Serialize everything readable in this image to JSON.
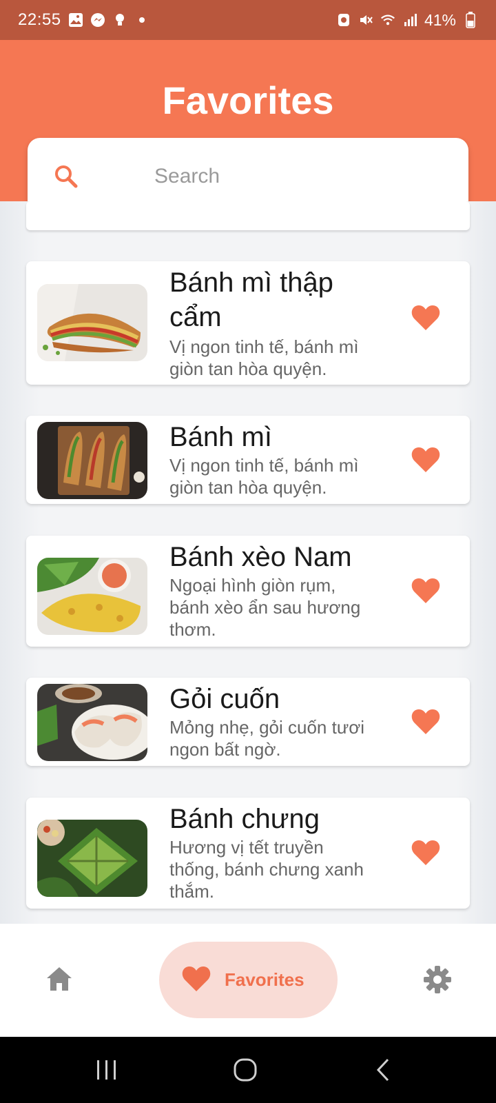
{
  "status_bar": {
    "time": "22:55",
    "battery_percent": "41%",
    "icons_left": [
      "gallery-icon",
      "messenger-icon",
      "bulb-icon",
      "dot-icon"
    ],
    "icons_right": [
      "battery-saver-icon",
      "mute-icon",
      "wifi-icon",
      "signal-icon",
      "battery-icon"
    ]
  },
  "header": {
    "title": "Favorites",
    "background_color": "#f57753"
  },
  "search": {
    "placeholder": "Search",
    "icon": "search-icon"
  },
  "favorites": [
    {
      "title": "Bánh mì thập cẩm",
      "description": "Vị ngon tinh tế, bánh mì giòn tan hòa quyện.",
      "image": "banh-mi-thap-cam-photo",
      "favorited": true
    },
    {
      "title": "Bánh mì",
      "description": "Vị ngon tinh tế, bánh mì giòn tan hòa quyện.",
      "image": "banh-mi-photo",
      "favorited": true
    },
    {
      "title": "Bánh xèo Nam",
      "description": "Ngoại hình giòn rụm, bánh xèo ẩn sau hương thơm.",
      "image": "banh-xeo-photo",
      "favorited": true
    },
    {
      "title": "Gỏi cuốn",
      "description": "Mỏng nhẹ, gỏi cuốn tươi ngon bất ngờ.",
      "image": "goi-cuon-photo",
      "favorited": true
    },
    {
      "title": "Bánh chưng",
      "description": "Hương vị tết truyền thống, bánh chưng xanh thắm.",
      "image": "banh-chung-photo",
      "favorited": true
    }
  ],
  "bottom_nav": {
    "items": [
      {
        "icon": "home-icon",
        "label": ""
      },
      {
        "icon": "heart-icon",
        "label": "Favorites",
        "active": true
      },
      {
        "icon": "gear-icon",
        "label": ""
      }
    ],
    "accent_color": "#f0704d",
    "active_pill_color": "#f9dcd6"
  },
  "system_nav": {
    "buttons": [
      "recent-apps-icon",
      "home-circle-icon",
      "back-icon"
    ]
  }
}
